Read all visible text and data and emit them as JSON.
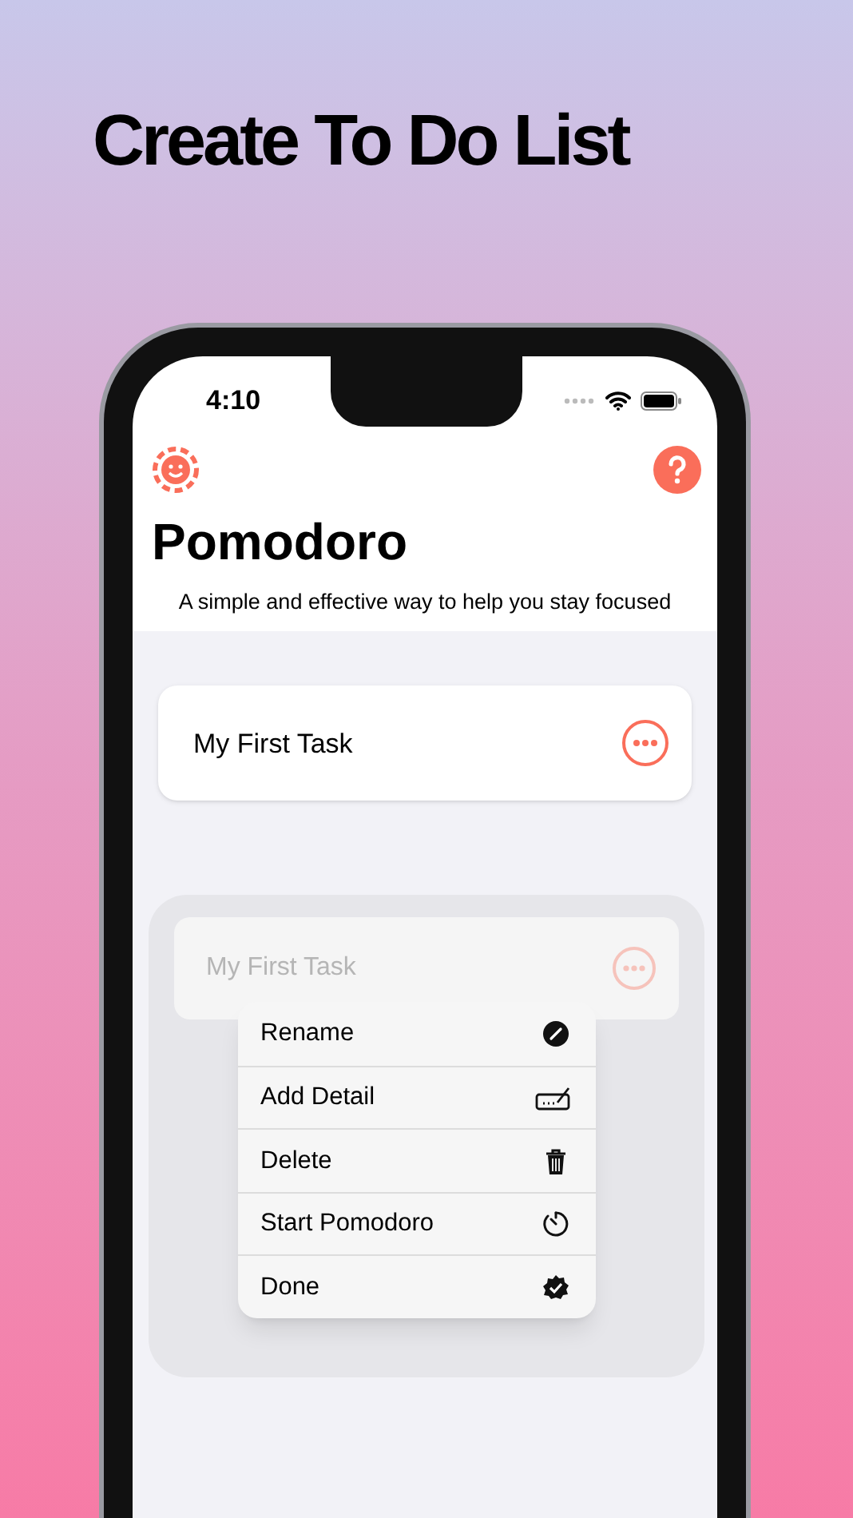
{
  "headline": "Create To Do List",
  "status_bar": {
    "time": "4:10"
  },
  "title": "Pomodoro",
  "subtitle": "A simple and effective way to help you stay focused",
  "tasks": [
    {
      "title": "My First Task"
    }
  ],
  "context_menu": {
    "preview": {
      "title": "My First Task"
    },
    "items": [
      {
        "label": "Rename",
        "kind": "pencil"
      },
      {
        "label": "Add Detail",
        "kind": "signature"
      },
      {
        "label": "Delete",
        "kind": "trash"
      },
      {
        "label": "Start Pomodoro",
        "kind": "timer"
      },
      {
        "label": "Done",
        "kind": "check-badge"
      }
    ]
  }
}
